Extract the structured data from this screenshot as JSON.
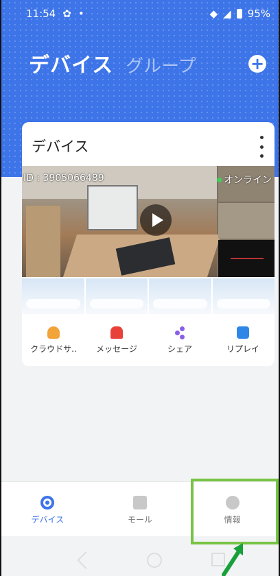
{
  "status": {
    "time": "11:54",
    "battery": "95%"
  },
  "header": {
    "tab_active": "デバイス",
    "tab_inactive": "グループ"
  },
  "device_card": {
    "title": "デバイス",
    "camera_id": "ID : 3905066489",
    "status": "オンライン"
  },
  "actions": [
    {
      "label": "クラウドサ..",
      "icon": "cloud-icon"
    },
    {
      "label": "メッセージ",
      "icon": "alarm-icon"
    },
    {
      "label": "シェア",
      "icon": "share-icon"
    },
    {
      "label": "リプレイ",
      "icon": "replay-icon"
    }
  ],
  "bottom_nav": [
    {
      "label": "デバイス",
      "icon": "device-icon"
    },
    {
      "label": "モール",
      "icon": "mall-icon"
    },
    {
      "label": "情報",
      "icon": "profile-icon"
    }
  ],
  "colors": {
    "primary": "#3d74e8",
    "highlight": "#77c444"
  }
}
